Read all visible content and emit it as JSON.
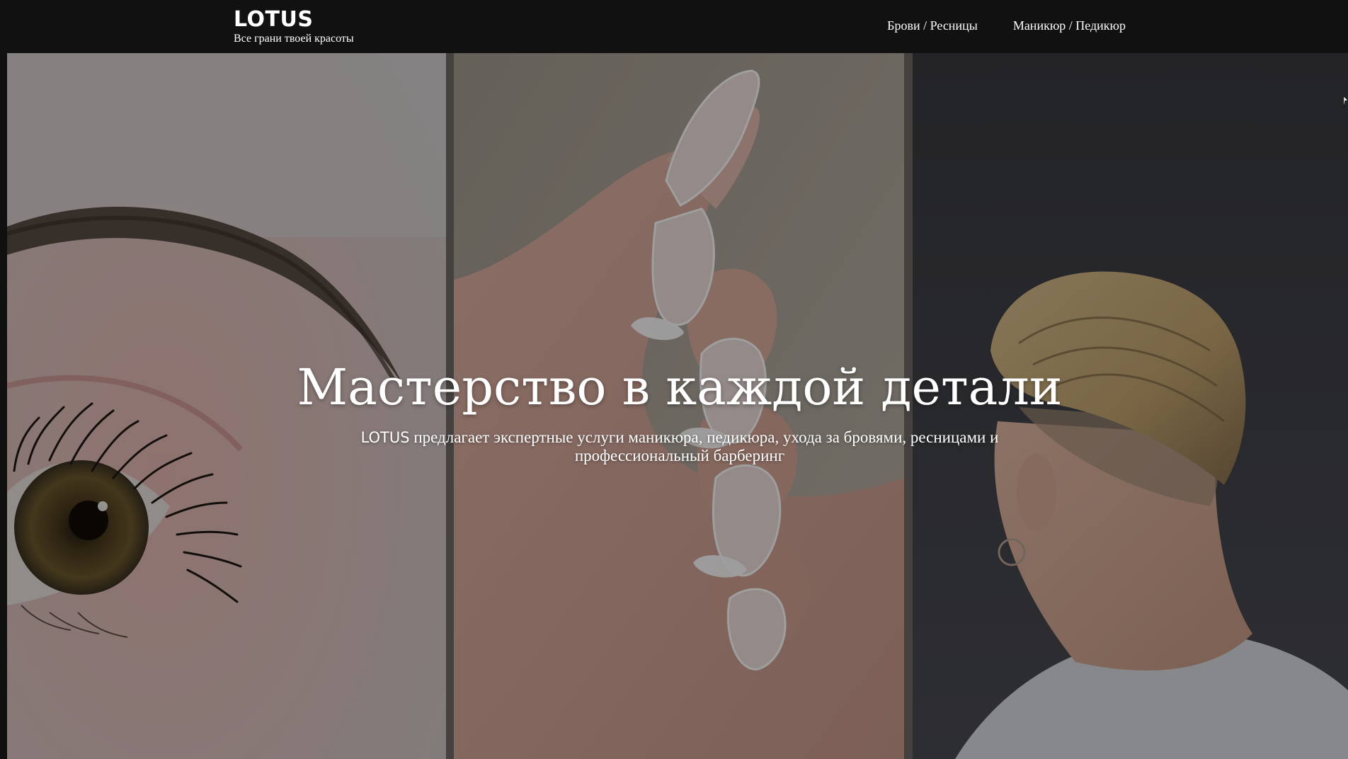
{
  "header": {
    "brand_name": "LOTUS",
    "tagline": "Все грани твоей красоты",
    "nav": [
      {
        "label": "Брови / Ресницы"
      },
      {
        "label": "Маникюр / Педикюр"
      }
    ]
  },
  "hero": {
    "title": "Мастерство в каждой детали",
    "subtitle_brand": "LOTUS",
    "subtitle_text": " предлагает экспертные услуги маникюра, педикюра, ухода за бровями, ресницами и профессиональный барберинг",
    "images": [
      {
        "icon": "eye-lashes-photo"
      },
      {
        "icon": "manicure-hand-photo"
      },
      {
        "icon": "barber-haircut-photo"
      }
    ]
  },
  "colors": {
    "header_bg": "#111111",
    "text": "#ffffff"
  }
}
